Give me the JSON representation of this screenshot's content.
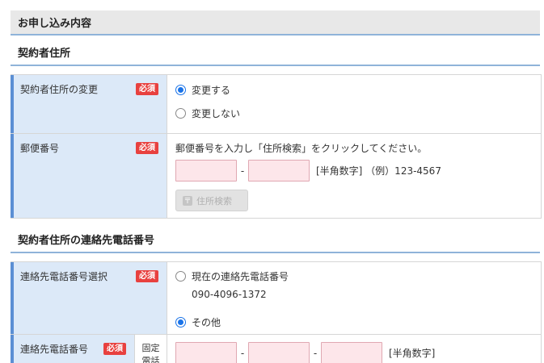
{
  "section_title": "お申し込み内容",
  "address": {
    "heading": "契約者住所",
    "change": {
      "label": "契約者住所の変更",
      "badge": "必須",
      "options": [
        "変更する",
        "変更しない"
      ]
    },
    "postal": {
      "label": "郵便番号",
      "badge": "必須",
      "instruction": "郵便番号を入力し「住所検索」をクリックしてください。",
      "hint": "[半角数字] （例）123-4567",
      "search_label": "住所検索"
    }
  },
  "phone": {
    "heading": "契約者住所の連絡先電話番号",
    "select": {
      "label": "連絡先電話番号選択",
      "badge": "必須",
      "current_label": "現在の連絡先電話番号",
      "current_number": "090-4096-1372",
      "other_label": "その他"
    },
    "number": {
      "label": "連絡先電話番号",
      "badge": "必須",
      "sub_label": "固定電話",
      "hint": "[半角数字]"
    }
  }
}
